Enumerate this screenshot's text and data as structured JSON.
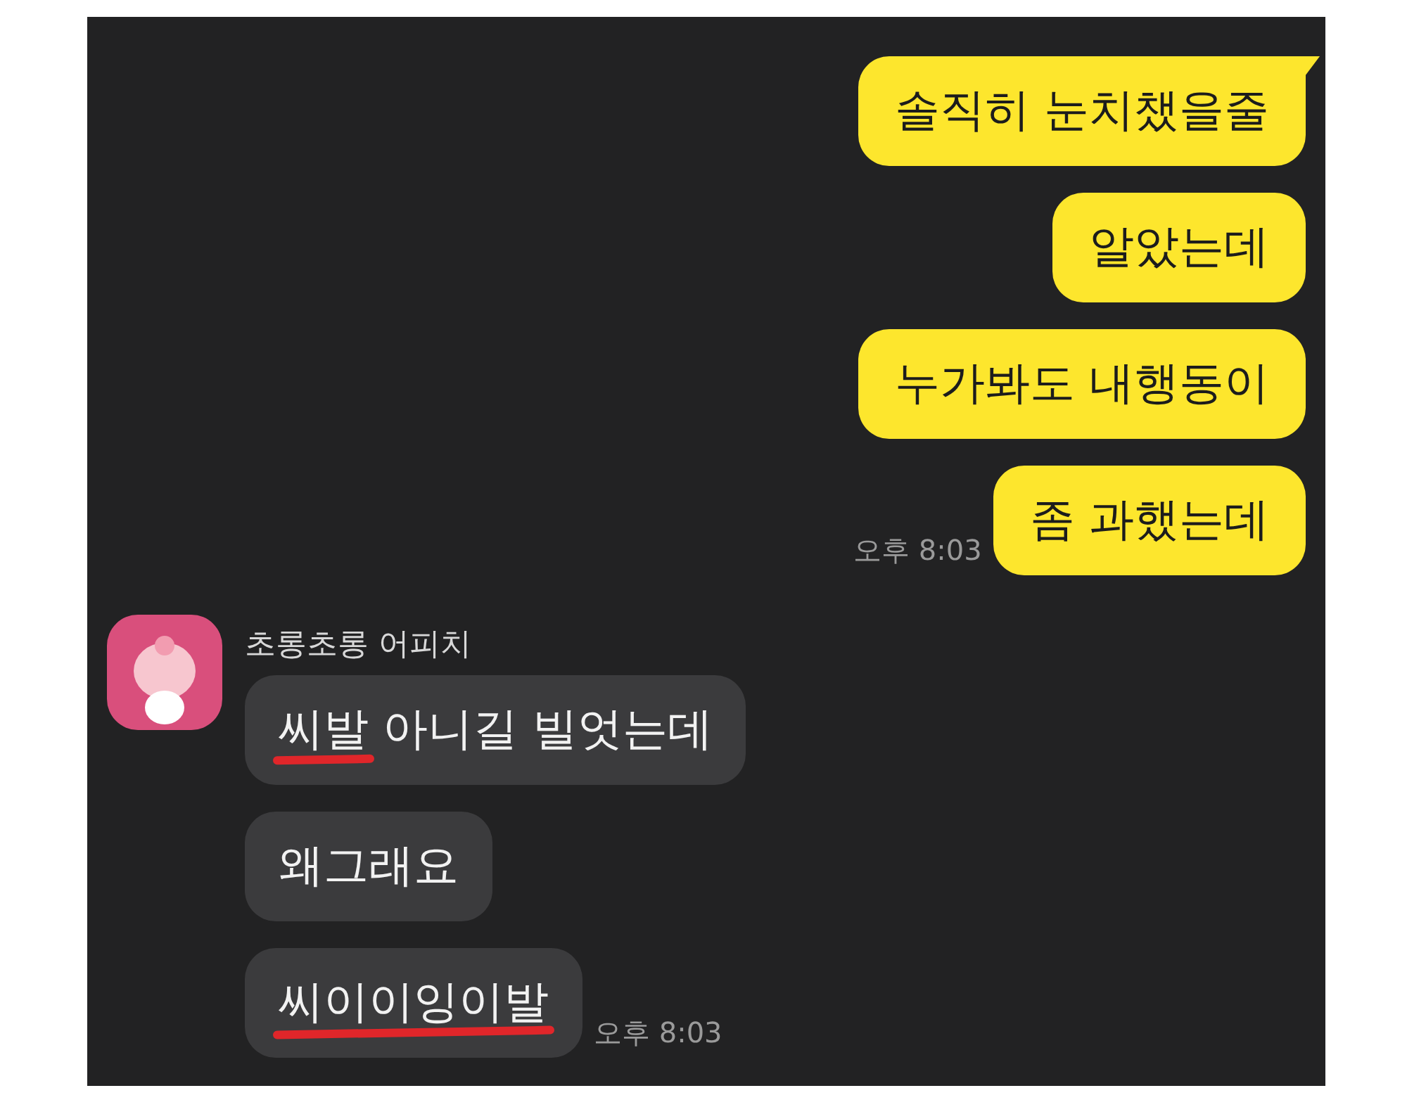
{
  "sent": {
    "messages": [
      {
        "text": "솔직히 눈치챘을줄",
        "tail": true
      },
      {
        "text": "알았는데",
        "tail": false
      },
      {
        "text": "누가봐도 내행동이",
        "tail": false
      },
      {
        "text": "좀 과했는데",
        "tail": false
      }
    ],
    "time": "오후 8:03"
  },
  "received": {
    "sender": "초롱초롱 어피치",
    "messages": [
      {
        "segments": [
          {
            "text": "씨발",
            "censored": true
          },
          {
            "text": " 아니길 빌엇는데",
            "censored": false
          }
        ]
      },
      {
        "segments": [
          {
            "text": "왜그래요",
            "censored": false
          }
        ]
      },
      {
        "segments": [
          {
            "text": "씨이이잉이발",
            "censored": true
          }
        ]
      }
    ],
    "time": "오후 8:03"
  }
}
